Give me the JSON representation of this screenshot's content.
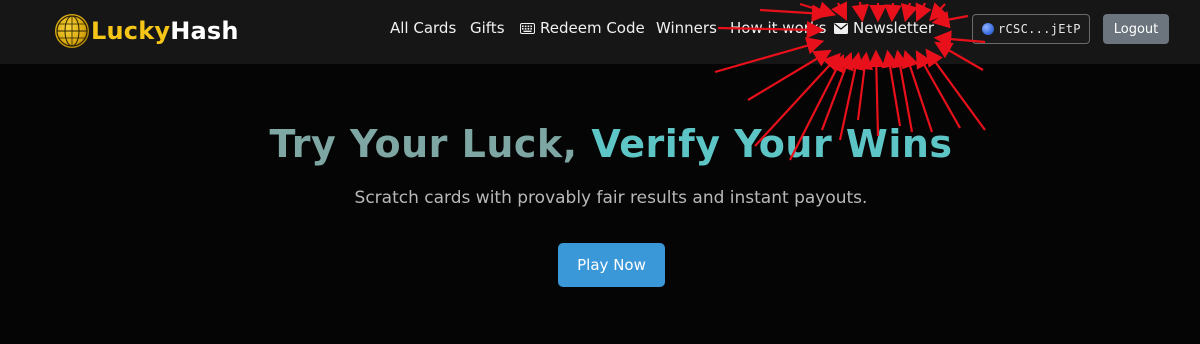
{
  "brand": {
    "name_part1": "Lucky",
    "name_part2": "Hash",
    "logo_icon": "globe-coin-icon"
  },
  "nav": {
    "items": [
      {
        "label": "All Cards"
      },
      {
        "label": "Gifts"
      },
      {
        "label": "Redeem Code",
        "icon": "keyboard-icon"
      },
      {
        "label": "Winners"
      },
      {
        "label": "How it works"
      },
      {
        "label": "Newsletter",
        "icon": "envelope-icon"
      }
    ]
  },
  "wallet": {
    "address": "rCSC...jEtP",
    "icon": "wallet-orb-icon"
  },
  "logout": {
    "label": "Logout"
  },
  "hero": {
    "title_part1": "Try Your Luck,",
    "title_part2": "Verify Your Wins",
    "subtitle": "Scratch cards with provably fair results and instant payouts.",
    "cta_label": "Play Now"
  },
  "colors": {
    "navbar_bg": "#161616",
    "page_bg": "#050505",
    "brand_yellow": "#f5c518",
    "title_muted_teal": "#7ea7a4",
    "title_teal": "#5dc5c6",
    "cta_blue": "#3a97d8",
    "logout_gray": "#6c757d",
    "annotation_red": "#e8101a"
  }
}
